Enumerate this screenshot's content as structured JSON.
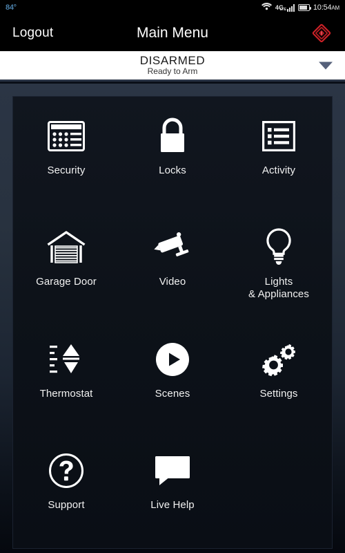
{
  "statusbar": {
    "temperature": "84°",
    "wifi_icon": "wifi-icon",
    "network_label": "4G",
    "network_sub": "LTE",
    "signal_icon": "signal-bars-icon",
    "battery_icon": "battery-icon",
    "time": "10:54",
    "ampm": "AM"
  },
  "header": {
    "logout_label": "Logout",
    "title": "Main Menu",
    "panic_icon": "panic-alarm-icon",
    "panic_color": "#cc2127"
  },
  "banner": {
    "status": "DISARMED",
    "substatus": "Ready to Arm",
    "caret_icon": "chevron-down-icon",
    "background": "#ffffff",
    "rule_color": "#2a3446"
  },
  "menu": {
    "items": [
      {
        "label": "Security",
        "icon": "keypad-icon"
      },
      {
        "label": "Locks",
        "icon": "padlock-icon"
      },
      {
        "label": "Activity",
        "icon": "list-icon"
      },
      {
        "label": "Garage Door",
        "icon": "garage-door-icon"
      },
      {
        "label": "Video",
        "icon": "security-camera-icon"
      },
      {
        "label": "Lights\n& Appliances",
        "icon": "lightbulb-icon",
        "line1": "Lights",
        "line2": "& Appliances"
      },
      {
        "label": "Thermostat",
        "icon": "thermostat-icon"
      },
      {
        "label": "Scenes",
        "icon": "play-circle-icon"
      },
      {
        "label": "Settings",
        "icon": "gears-icon"
      },
      {
        "label": "Support",
        "icon": "question-circle-icon"
      },
      {
        "label": "Live Help",
        "icon": "chat-bubble-icon"
      }
    ]
  },
  "theme": {
    "icon_color": "#ffffff",
    "panel_background": "#0d1219",
    "page_background": "#2b3545"
  }
}
